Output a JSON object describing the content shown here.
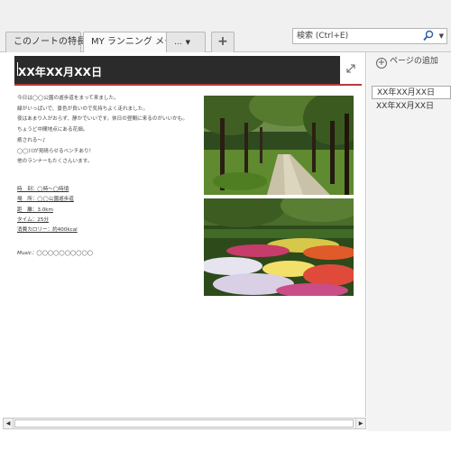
{
  "tabs": [
    {
      "label": "このノートの特長"
    },
    {
      "label": "MY ランニング メモ"
    },
    {
      "label": "...",
      "dropdown": "▼"
    },
    {
      "label": "+"
    }
  ],
  "search": {
    "placeholder": "検索 (Ctrl+E)",
    "dropdown": "▼"
  },
  "page": {
    "title": "XX年XX月XX日",
    "body_lines": [
      "今日は◯◯公園の遊歩道をまって来ました。",
      "緑がいっぱいで、景色が良いので気持ちよく走れました。",
      "夜はあまり人がおらず、静かでいいです。休日の昼間に来るのがいいかも。",
      "ちょうど中間地点にある花畑。",
      "癒される〜♪",
      "◯◯川が見晴らせるベンチあり！",
      "他のランナーもたくさんいます。"
    ],
    "stats": [
      "時　刻：◯時〜◯時頃",
      "場　所：◯◯公園遊歩道",
      "距　離：3.0km",
      "タイム：25分",
      "消費カロリー：約400kcal"
    ],
    "music_label": "Music：",
    "music_value": "◯◯◯◯◯◯◯◯◯◯"
  },
  "pagelist": {
    "add_label": "ページの追加",
    "items": [
      {
        "label": "XX年XX月XX日",
        "selected": true
      },
      {
        "label": "XX年XX月XX日",
        "selected": false
      }
    ]
  },
  "icons": {
    "expand": "expand-icon",
    "search": "magnifier-icon",
    "add": "plus-circle-icon",
    "scroll_left": "◀",
    "scroll_right": "▶"
  },
  "colors": {
    "title_bar": "#2b2b2b",
    "title_underline": "#b83a3a",
    "selected_page_bg": "#ffffff",
    "pane_bg": "#f3f3f3"
  }
}
